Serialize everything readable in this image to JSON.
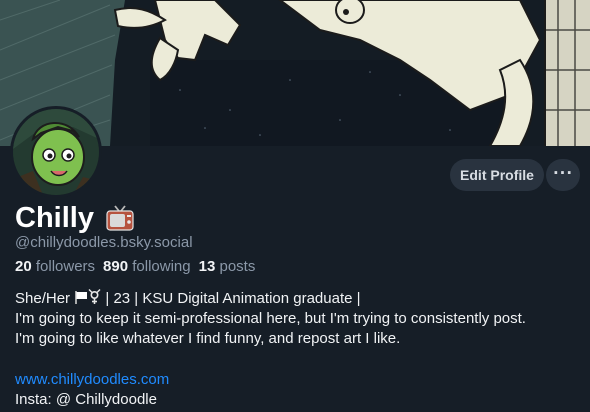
{
  "profile": {
    "display_name": "Chilly",
    "handle": "@chillydoodles.bsky.social",
    "edit_label": "Edit Profile",
    "more_label": "···"
  },
  "stats": {
    "followers_count": "20",
    "followers_label": "followers",
    "following_count": "890",
    "following_label": "following",
    "posts_count": "13",
    "posts_label": "posts"
  },
  "bio": {
    "line1_a": "She/Her",
    "line1_b": "| 23 | KSU Digital Animation graduate |",
    "line2": "I'm going to keep it semi-professional here, but I'm trying to consistently post.",
    "line3": "I'm going to like whatever I find funny, and repost art I like.",
    "link": "www.chillydoodles.com",
    "insta": "Insta: @ Chillydoodle"
  },
  "icons": {
    "name_emoji": "television-icon",
    "bio_emoji": [
      "white-flag-icon",
      "transgender-symbol-icon"
    ]
  },
  "colors": {
    "background": "#161e27",
    "accent_link": "#208bfe",
    "muted_text": "#8b98a8",
    "button_bg": "#29333f"
  }
}
